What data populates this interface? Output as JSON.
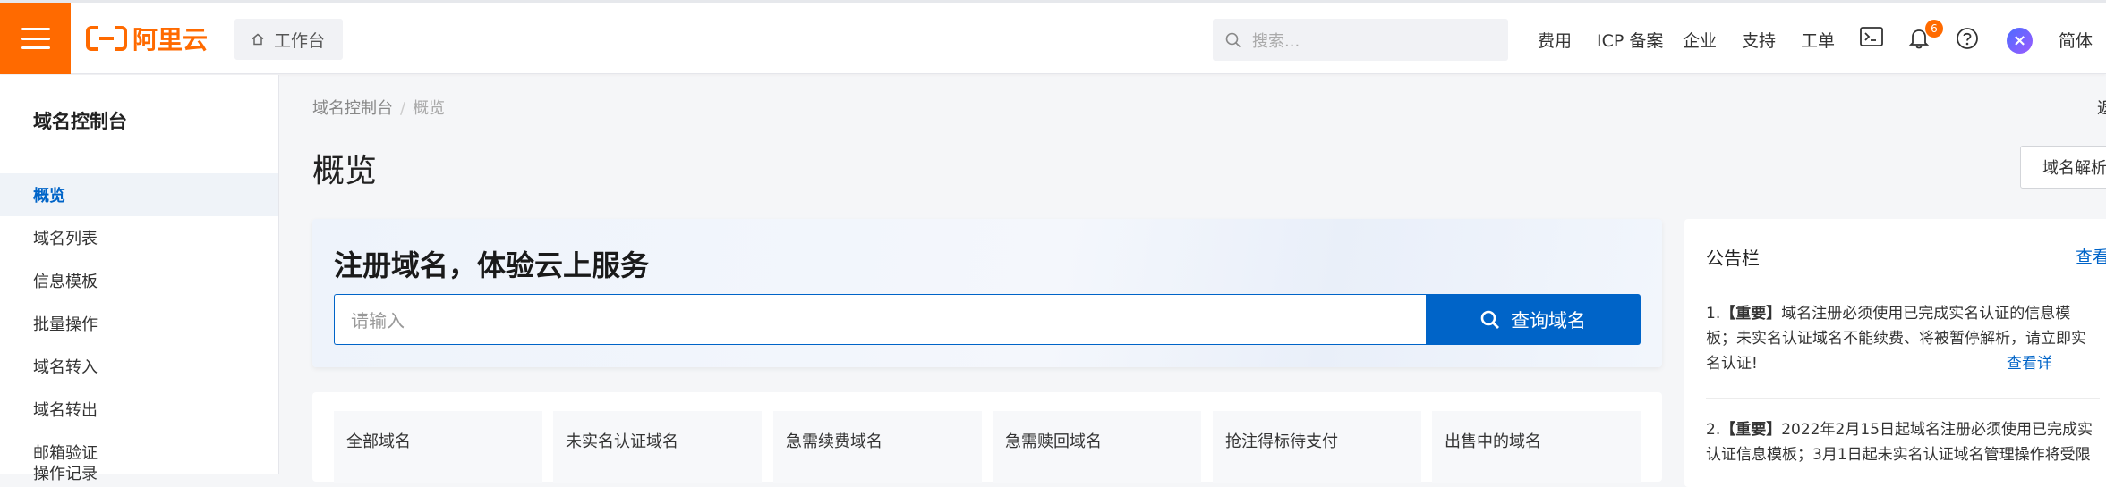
{
  "topbar": {
    "logo_text": "阿里云",
    "workbench_label": "工作台",
    "search_placeholder": "搜索...",
    "nav": [
      "费用",
      "ICP 备案",
      "企业",
      "支持",
      "工单"
    ],
    "notification_count": "6",
    "language_label": "简体"
  },
  "sidebar": {
    "title": "域名控制台",
    "items": [
      {
        "label": "概览",
        "active": true
      },
      {
        "label": "域名列表"
      },
      {
        "label": "信息模板"
      },
      {
        "label": "批量操作"
      },
      {
        "label": "域名转入"
      },
      {
        "label": "域名转出"
      },
      {
        "label": "邮箱验证"
      },
      {
        "label": "操作记录"
      }
    ]
  },
  "breadcrumb": {
    "root": "域名控制台",
    "separator": "/",
    "current": "概览"
  },
  "page": {
    "title": "概览",
    "right_clip_text": "返",
    "dns_button_label": "域名解析"
  },
  "register": {
    "title": "注册域名，体验云上服务",
    "input_placeholder": "请输入",
    "search_button_label": "查询域名"
  },
  "stats": {
    "tabs": [
      "全部域名",
      "未实名认证域名",
      "急需续费域名",
      "急需赎回域名",
      "抢注得标待支付",
      "出售中的域名"
    ]
  },
  "notice": {
    "title": "公告栏",
    "more_label": "查看",
    "items": [
      {
        "index": "1.",
        "tag": "【重要】",
        "line1": "域名注册必须使用已完成实名认证的信息模",
        "line2": "板；未实名认证域名不能续费、将被暂停解析，请立即实",
        "line3": "名认证!",
        "link": "查看详"
      },
      {
        "index": "2.",
        "tag": "【重要】",
        "line1": "2022年2月15日起域名注册必须使用已完成实",
        "line2": "认证信息模板；3月1日起未实名认证域名管理操作将受限"
      }
    ]
  },
  "colors": {
    "brand_orange": "#ff6a00",
    "primary_blue": "#0064c8"
  }
}
